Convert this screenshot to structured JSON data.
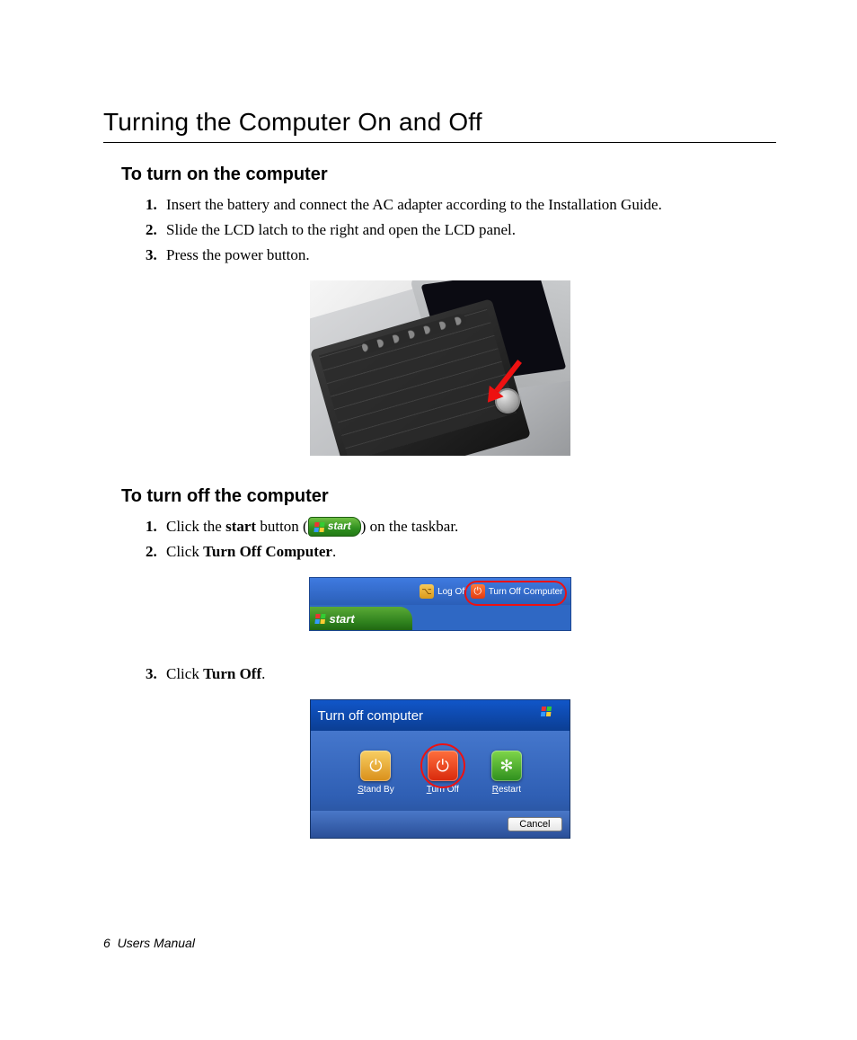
{
  "title": "Turning the Computer On and Off",
  "section_on": {
    "heading": "To turn on the computer",
    "steps": [
      "Insert the battery and connect the AC adapter according to the Installation Guide.",
      "Slide the LCD latch to the right and open the LCD panel.",
      "Press the power button."
    ]
  },
  "section_off": {
    "heading": "To turn off the computer",
    "step1_pre": "Click the ",
    "step1_bold": "start",
    "step1_mid": " button (",
    "step1_post": ") on the taskbar.",
    "step2_pre": "Click ",
    "step2_bold": "Turn Off Computer",
    "step2_post": ".",
    "step3_pre": "Click ",
    "step3_bold": "Turn Off",
    "step3_post": "."
  },
  "start_button_label": "start",
  "start_menu": {
    "logoff": "Log Off",
    "turnoff": "Turn Off Computer",
    "start": "start"
  },
  "dialog": {
    "title": "Turn off computer",
    "standby": "Stand By",
    "turnoff": "Turn Off",
    "restart": "Restart",
    "cancel": "Cancel"
  },
  "footer": {
    "page": "6",
    "label": "Users Manual"
  }
}
